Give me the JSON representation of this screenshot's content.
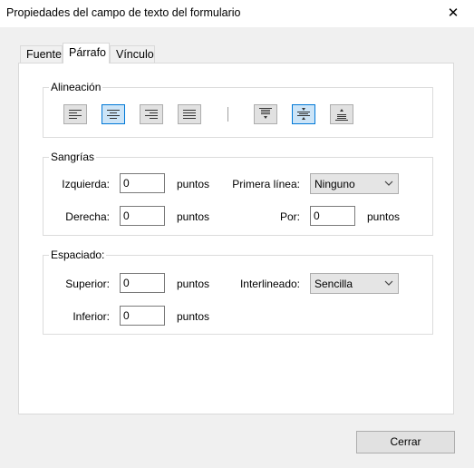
{
  "window": {
    "title": "Propiedades del campo de texto del formulario",
    "close_glyph": "✕"
  },
  "tabs": [
    {
      "label": "Fuente"
    },
    {
      "label": "Párrafo"
    },
    {
      "label": "Vínculo"
    }
  ],
  "alignment": {
    "label": "Alineación",
    "horizontal": [
      {
        "icon": "align-left-icon",
        "selected": false
      },
      {
        "icon": "align-center-icon",
        "selected": true
      },
      {
        "icon": "align-right-icon",
        "selected": false
      },
      {
        "icon": "align-justify-icon",
        "selected": false
      }
    ],
    "vertical": [
      {
        "icon": "align-top-icon",
        "selected": false
      },
      {
        "icon": "align-middle-icon",
        "selected": true
      },
      {
        "icon": "align-bottom-icon",
        "selected": false
      }
    ]
  },
  "indents": {
    "label": "Sangrías",
    "left_label": "Izquierda:",
    "left_value": "0",
    "left_unit": "puntos",
    "right_label": "Derecha:",
    "right_value": "0",
    "right_unit": "puntos",
    "first_line_label": "Primera línea:",
    "first_line_value": "Ninguno",
    "by_label": "Por:",
    "by_value": "0",
    "by_unit": "puntos"
  },
  "spacing": {
    "label": "Espaciado:",
    "top_label": "Superior:",
    "top_value": "0",
    "top_unit": "puntos",
    "bottom_label": "Inferior:",
    "bottom_value": "0",
    "bottom_unit": "puntos",
    "line_label": "Interlineado:",
    "line_value": "Sencilla"
  },
  "footer": {
    "close_label": "Cerrar"
  },
  "colors": {
    "selected_border": "#0078d7",
    "selected_fill": "#cce4f7"
  }
}
